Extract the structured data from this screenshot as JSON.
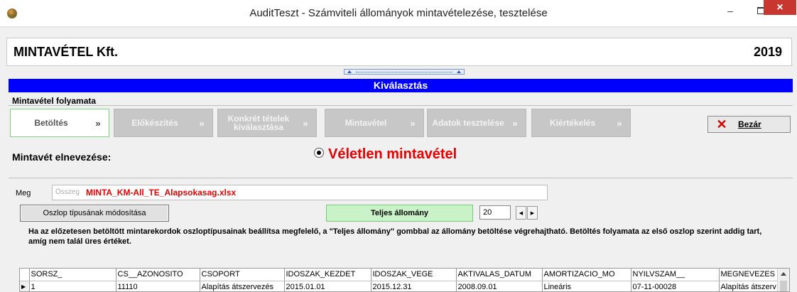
{
  "window": {
    "title": "AuditTeszt - Számviteli állományok mintavételezése, tesztelése",
    "minimize": "–",
    "close": "×"
  },
  "header": {
    "company": "MINTAVÉTEL Kft.",
    "year": "2019"
  },
  "band": {
    "title": "Kiválasztás"
  },
  "process": {
    "label": "Mintavétel folyamata",
    "steps": [
      {
        "label": "Betöltés",
        "chevron": "»",
        "active": true
      },
      {
        "label": "Előkészítés",
        "chevron": "»",
        "active": false
      },
      {
        "label": "Konkrét tételek kiválasztása",
        "chevron": "»",
        "active": false
      },
      {
        "label": "Mintavétel",
        "chevron": "»",
        "active": false
      },
      {
        "label": "Adatok tesztelése",
        "chevron": "»",
        "active": false
      },
      {
        "label": "Kiértékelés",
        "chevron": "»",
        "active": false
      }
    ],
    "close_label": "Bezár"
  },
  "sampling": {
    "name_label": "Mintavét elnevezése:",
    "method": "Véletlen mintavétel"
  },
  "load": {
    "meg_label": "Meg",
    "file_placeholder": "Összeg",
    "file_value": "MINTA_KM-All_TE_Alapsokasag.xlsx",
    "column_type_button": "Oszlop típusának módosítása",
    "full_set_button": "Teljes állomány",
    "count": "20",
    "hint": "Ha az előzetesen betöltött mintarekordok oszloptípusainak beállítsa megfelelő, a \"Teljes állomány\" gombbal az állomány betöltése végrehajtható. Betöltés folyamata az első oszlop szerint addig tart, amíg nem talál üres értéket."
  },
  "grid": {
    "columns": [
      "SORSZ_",
      "CS__AZONOSITO",
      "CSOPORT",
      "IDOSZAK_KEZDET",
      "IDOSZAK_VEGE",
      "AKTIVALAS_DATUM",
      "AMORTIZACIO_MO",
      "NYILVSZAM__",
      "MEGNEVEZES"
    ],
    "rows": [
      {
        "indicator": "▶",
        "cells": [
          "1",
          "11110",
          "Alapítás átszervezés",
          "2015.01.01",
          "2015.12.31",
          "2008.09.01",
          "Lineáris",
          "07-11-00028",
          "Alapítás átszerv"
        ]
      }
    ]
  }
}
